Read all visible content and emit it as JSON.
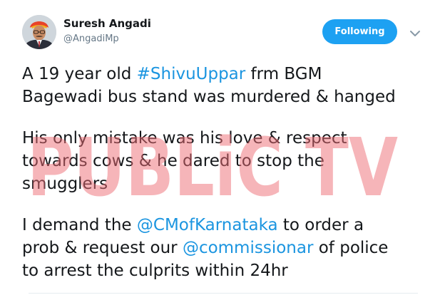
{
  "user": {
    "name": "Suresh Angadi",
    "handle": "@AngadiMp"
  },
  "actions": {
    "follow_label": "Following"
  },
  "tweet": {
    "p1": {
      "hashtag": "#ShivuUppar",
      "line1_pre": "A 19 year old ",
      "line1_post": " frm BGM",
      "line2": "Bagewadi bus stand was murdered & hanged"
    },
    "p2": {
      "line1": "His only mistake was his love & respect",
      "line2": "towards cows & he dared to stop the",
      "line3": "smugglers"
    },
    "p3": {
      "line1_pre": "I demand the ",
      "mention1": "@CMofKarnataka",
      "line1_post": " to order a",
      "line2_pre": "prob & request our ",
      "mention2": "@commissionar",
      "line2_post": " of police",
      "line3": "to arrest the culprits within 24hr"
    }
  },
  "watermark": {
    "text": "PUBLiC TV",
    "color": "#ee6b73"
  },
  "colors": {
    "accent": "#1da1f2",
    "link": "#1b95e0",
    "text": "#14171a",
    "muted": "#657786"
  }
}
